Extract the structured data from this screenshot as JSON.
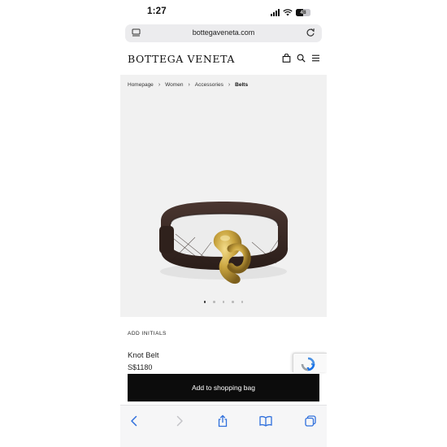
{
  "status_bar": {
    "time": "1:27",
    "battery": "48"
  },
  "browser": {
    "url": "bottegaveneta.com"
  },
  "site": {
    "brand": "BOTTEGA VENETA"
  },
  "breadcrumb": {
    "items": [
      "Homepage",
      "Women",
      "Accessories"
    ],
    "current": "Belts"
  },
  "gallery": {
    "image_count": 5,
    "active_index": 0
  },
  "product": {
    "add_initials": "ADD INITIALS",
    "name": "Knot Belt",
    "price": "S$1180"
  },
  "cta": {
    "label": "Add to shopping bag"
  },
  "colors": {
    "accent": "#0c0c0c",
    "product_bg": "#f1f1f1",
    "leather": "#3a2a24",
    "brass": "#c9a43f",
    "link_blue": "#2f6fdc"
  },
  "icons": {
    "header": [
      "bag-icon",
      "search-icon",
      "menu-icon"
    ],
    "toolbar": [
      "back-icon",
      "forward-icon",
      "share-icon",
      "bookmarks-icon",
      "tabs-icon"
    ]
  }
}
